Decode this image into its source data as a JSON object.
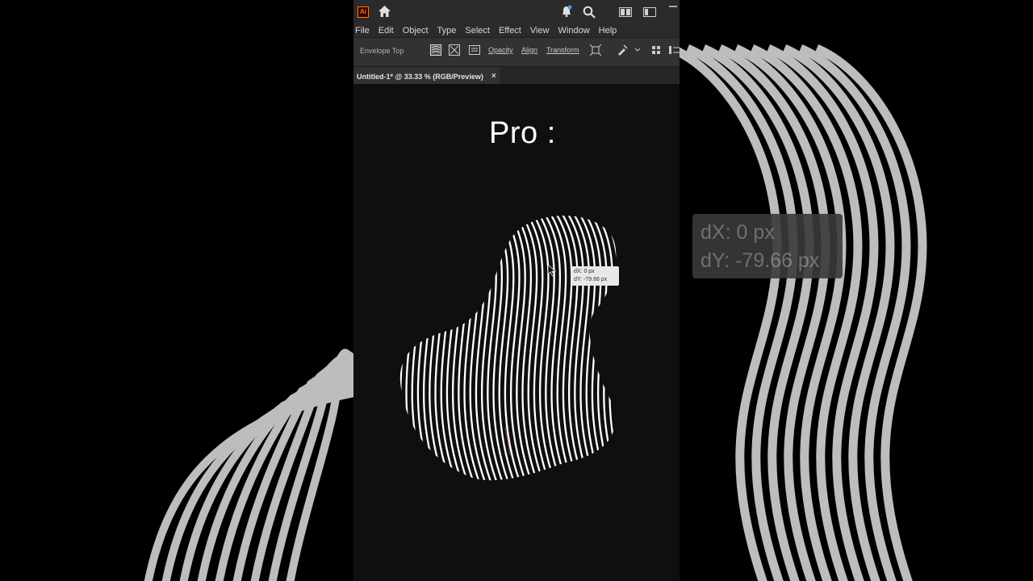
{
  "menu": [
    "File",
    "Edit",
    "Object",
    "Type",
    "Select",
    "Effect",
    "View",
    "Window",
    "Help"
  ],
  "control_bar": {
    "label": "Envelope Top",
    "links": [
      "Opacity",
      "Align",
      "Transform"
    ]
  },
  "document_tab": {
    "title": "Untitled-1* @ 33.33 % (RGB/Preview)",
    "close": "×"
  },
  "canvas": {
    "heading": "Pro :"
  },
  "tooltip": {
    "dx": "dX: 0 px",
    "dy": "dY: -79.66 px"
  },
  "app_logo": "Ai",
  "colors": {
    "accent": "#ff7c00",
    "ui_dark": "#2b2b2b",
    "canvas_bg": "#0f0f0f",
    "stripes": "#ffffff"
  },
  "icons": [
    "home-icon",
    "bell-icon",
    "search-icon",
    "workspace-icon",
    "arrange-icon",
    "minimize-icon"
  ]
}
